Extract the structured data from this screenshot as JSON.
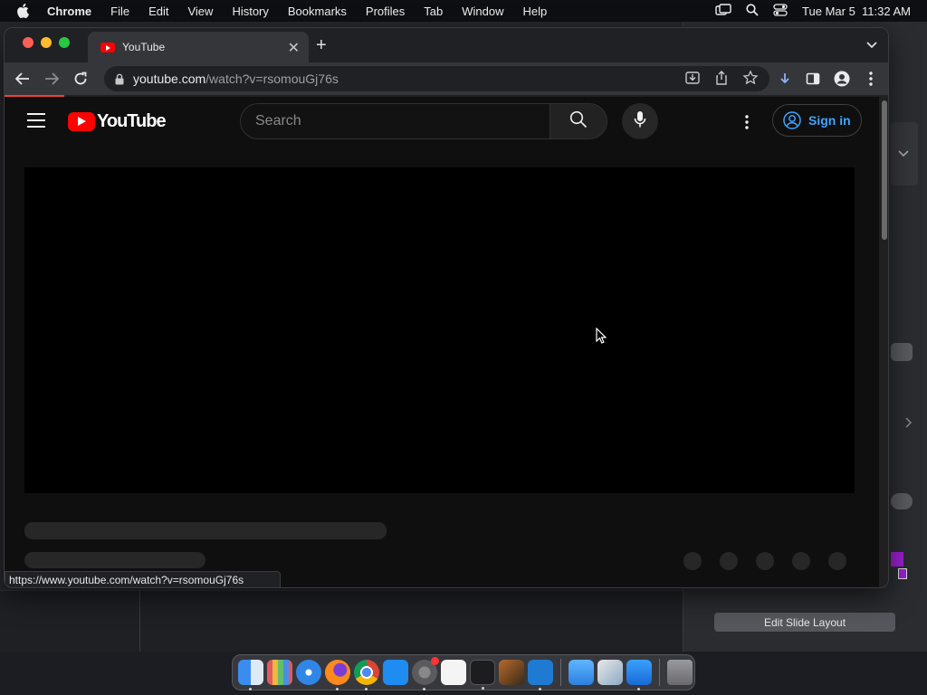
{
  "menubar": {
    "app_name": "Chrome",
    "menus": [
      "File",
      "Edit",
      "View",
      "History",
      "Bookmarks",
      "Profiles",
      "Tab",
      "Window",
      "Help"
    ],
    "clock": "Tue Mar 5  11:32 AM"
  },
  "browser": {
    "tab": {
      "title": "YouTube",
      "favicon": "youtube-icon"
    },
    "url": {
      "domain": "youtube.com",
      "path": "/watch?v=rsomouGj76s"
    },
    "status_url": "https://www.youtube.com/watch?v=rsomouGj76s"
  },
  "youtube": {
    "logo_text": "YouTube",
    "search_placeholder": "Search",
    "signin_label": "Sign in"
  },
  "background_app": {
    "edit_slide_layout_label": "Edit Slide Layout"
  },
  "dock": {
    "apps": [
      "finder-icon",
      "launchpad-icon",
      "safari-icon",
      "firefox-icon",
      "chrome-icon",
      "app-store-icon",
      "system-settings-icon",
      "textedit-icon",
      "terminal-icon",
      "garageband-icon",
      "vscode-icon",
      "icloud-icon",
      "preview-icon",
      "keynote-icon",
      "trash-icon"
    ]
  },
  "colors": {
    "youtube_red": "#ff0000",
    "link_blue": "#3ea6ff",
    "page_bg": "#0f0f0f"
  }
}
